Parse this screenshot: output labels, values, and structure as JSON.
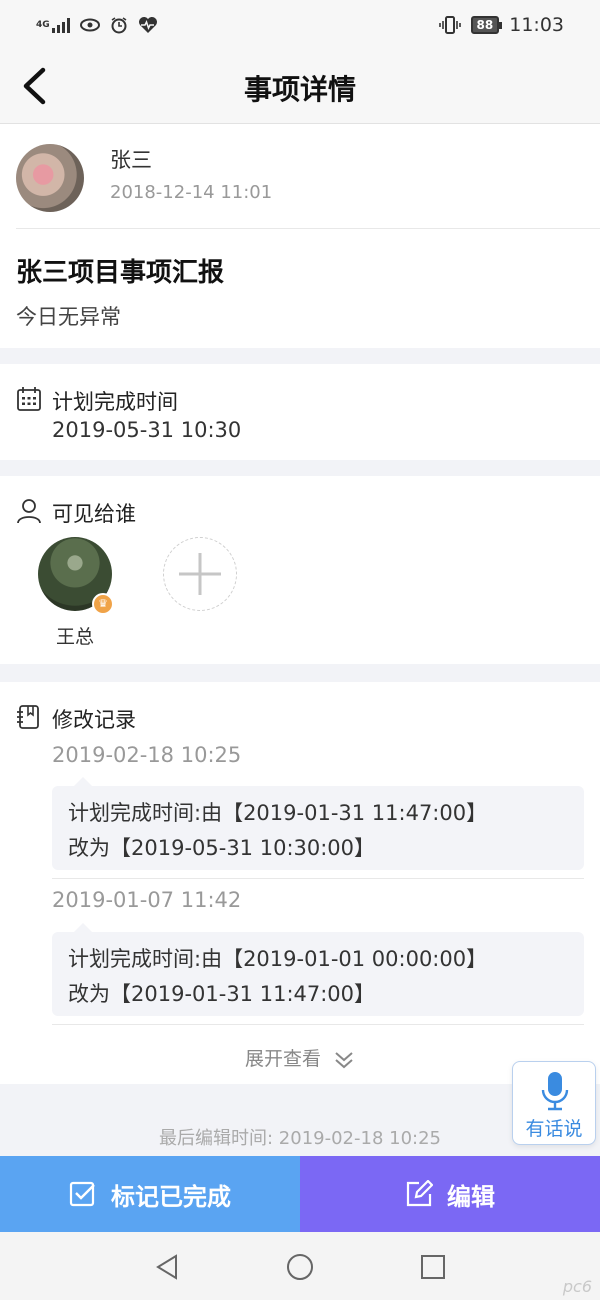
{
  "status_bar": {
    "network": "4G",
    "battery": "88",
    "time": "11:03"
  },
  "header": {
    "title": "事项详情"
  },
  "author": {
    "name": "张三",
    "time": "2018-12-14 11:01"
  },
  "report": {
    "title": "张三项目事项汇报",
    "body": "今日无异常"
  },
  "plan": {
    "label": "计划完成时间",
    "value": "2019-05-31 10:30"
  },
  "visible_to": {
    "label": "可见给谁",
    "members": [
      {
        "name": "王总"
      }
    ]
  },
  "history": {
    "label": "修改记录",
    "entries": [
      {
        "time": "2019-02-18 10:25",
        "line1": "计划完成时间:由【2019-01-31 11:47:00】",
        "line2": "改为【2019-05-31 10:30:00】"
      },
      {
        "time": "2019-01-07 11:42",
        "line1": "计划完成时间:由【2019-01-01 00:00:00】",
        "line2": "改为【2019-01-31 11:47:00】"
      }
    ],
    "expand_label": "展开查看"
  },
  "last_edit": "最后编辑时间: 2019-02-18 10:25",
  "voice": {
    "label": "有话说"
  },
  "actions": {
    "done_label": "标记已完成",
    "edit_label": "编辑"
  },
  "watermark": "pc6"
}
